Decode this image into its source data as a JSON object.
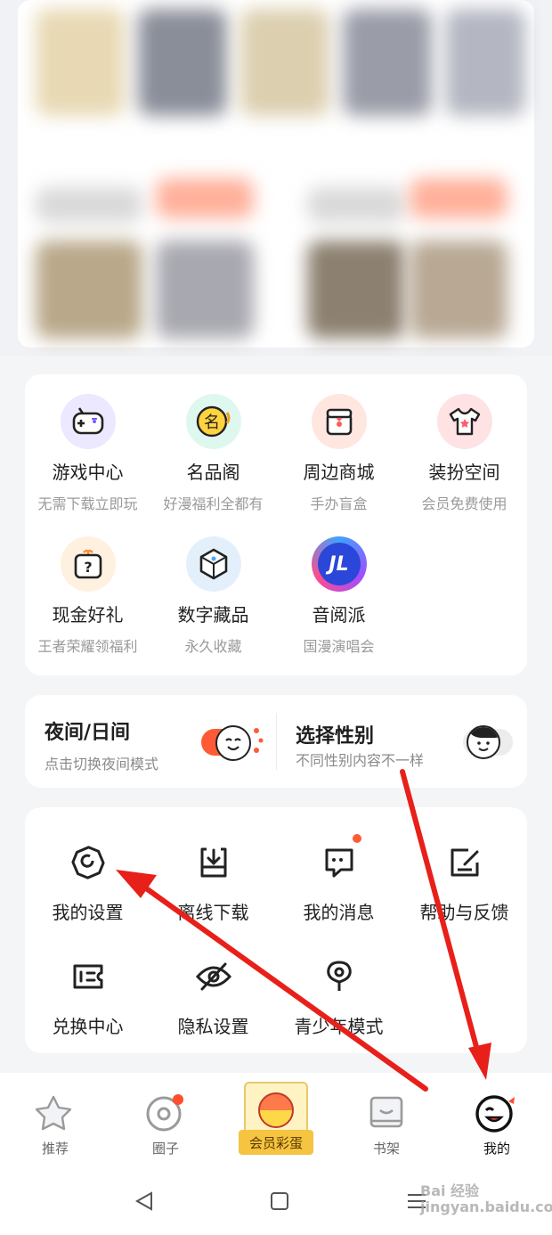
{
  "services": [
    {
      "title": "游戏中心",
      "sub": "无需下载立即玩",
      "icon": "game-controller-icon"
    },
    {
      "title": "名品阁",
      "sub": "好漫福利全都有",
      "icon": "ming-badge-icon"
    },
    {
      "title": "周边商城",
      "sub": "手办盲盒",
      "icon": "gift-box-icon"
    },
    {
      "title": "装扮空间",
      "sub": "会员免费使用",
      "icon": "tshirt-icon"
    },
    {
      "title": "现金好礼",
      "sub": "王者荣耀领福利",
      "icon": "mystery-box-icon"
    },
    {
      "title": "数字藏品",
      "sub": "永久收藏",
      "icon": "cube-icon"
    },
    {
      "title": "音阅派",
      "sub": "国漫演唱会",
      "icon": "music-party-icon"
    }
  ],
  "toggles": {
    "night": {
      "title": "夜间/日间",
      "sub": "点击切换夜间模式"
    },
    "gender": {
      "title": "选择性别",
      "sub": "不同性别内容不一样"
    }
  },
  "tools": [
    {
      "title": "我的设置",
      "icon": "settings-icon"
    },
    {
      "title": "离线下载",
      "icon": "download-icon"
    },
    {
      "title": "我的消息",
      "icon": "message-icon"
    },
    {
      "title": "帮助与反馈",
      "icon": "feedback-icon"
    },
    {
      "title": "兑换中心",
      "icon": "exchange-ticket-icon"
    },
    {
      "title": "隐私设置",
      "icon": "privacy-eye-icon"
    },
    {
      "title": "青少年模式",
      "icon": "youth-mode-icon"
    }
  ],
  "nav": [
    {
      "label": "推荐",
      "icon": "star-icon"
    },
    {
      "label": "圈子",
      "icon": "circle-icon"
    },
    {
      "label": "会员彩蛋",
      "icon": "member-egg-icon"
    },
    {
      "label": "书架",
      "icon": "bookshelf-icon"
    },
    {
      "label": "我的",
      "icon": "profile-face-icon"
    }
  ],
  "watermark": "Bai 经验 jingyan.baidu.com",
  "colors": {
    "accent": "#ff5a36",
    "arrow": "#e8201a",
    "active": "#111111"
  }
}
